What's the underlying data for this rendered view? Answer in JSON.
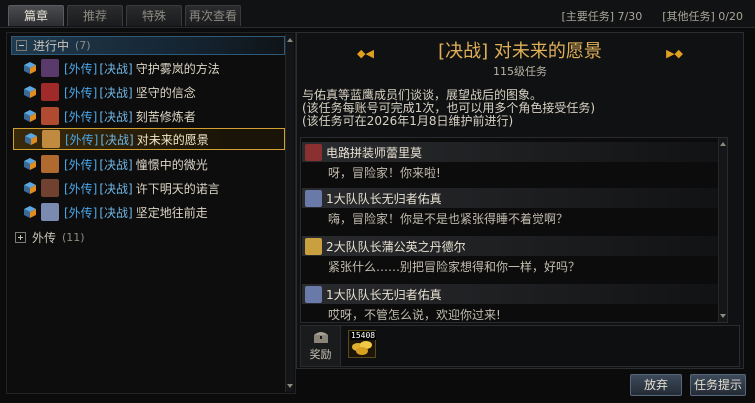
{
  "tabs": [
    {
      "label": "篇章",
      "active": true
    },
    {
      "label": "推荐",
      "active": false
    },
    {
      "label": "特殊",
      "active": false
    },
    {
      "label": "再次查看",
      "active": false
    }
  ],
  "counters": {
    "main": "[主要任务] 7/30",
    "other": "[其他任务] 0/20"
  },
  "groups": {
    "in_progress": {
      "label": "进行中",
      "count": "(7)"
    },
    "side_story": {
      "label": "外传",
      "count": "(11)"
    }
  },
  "quests": [
    {
      "tag1": "[外传]",
      "tag2": "[决战]",
      "name": "守护雾岚的方法",
      "face": "#5a3a6a",
      "selected": false
    },
    {
      "tag1": "[外传]",
      "tag2": "[决战]",
      "name": "坚守的信念",
      "face": "#a02a2a",
      "selected": false
    },
    {
      "tag1": "[外传]",
      "tag2": "[决战]",
      "name": "刻苦修炼者",
      "face": "#b04a30",
      "selected": false
    },
    {
      "tag1": "[外传]",
      "tag2": "[决战]",
      "name": "对未来的愿景",
      "face": "#c08a40",
      "selected": true
    },
    {
      "tag1": "[外传]",
      "tag2": "[决战]",
      "name": "憧憬中的微光",
      "face": "#b06a30",
      "selected": false
    },
    {
      "tag1": "[外传]",
      "tag2": "[决战]",
      "name": "许下明天的诺言",
      "face": "#704030",
      "selected": false
    },
    {
      "tag1": "[外传]",
      "tag2": "[决战]",
      "name": "坚定地往前走",
      "face": "#7a8ab0",
      "selected": false
    }
  ],
  "detail": {
    "title": "[决战]  对未来的愿景",
    "level": "115级任务",
    "desc_lines": [
      "与佑真等蓝鹰成员们谈谈，展望战后的图象。",
      "(该任务每账号可完成1次，也可以用多个角色接受任务)",
      "(该任务可在2026年1月8日维护前进行)"
    ]
  },
  "dialog": [
    {
      "speaker": "电路拼装师蕾里莫",
      "text": "呀，冒险家！你来啦!",
      "face": "#8a3030"
    },
    {
      "speaker": "1大队队长无归者佑真",
      "text": "嗨，冒险家！你是不是也紧张得睡不着觉啊？",
      "face": "#6a7aa8"
    },
    {
      "speaker": "2大队队长蒲公英之丹德尔",
      "text": "紧张什么……别把冒险家想得和你一样，好吗？",
      "face": "#c8a040"
    },
    {
      "speaker": "1大队队长无归者佑真",
      "text": "哎呀，不管怎么说，欢迎你过来!",
      "face": "#6a7aa8"
    }
  ],
  "reward": {
    "label": "奖励",
    "item_count": "15408"
  },
  "buttons": {
    "give_up": "放弃",
    "hint": "任务提示"
  },
  "colors": {
    "title_gold": "#e0b058",
    "tag_blue": "#4aa6e8",
    "selected_border": "#d0a030"
  }
}
